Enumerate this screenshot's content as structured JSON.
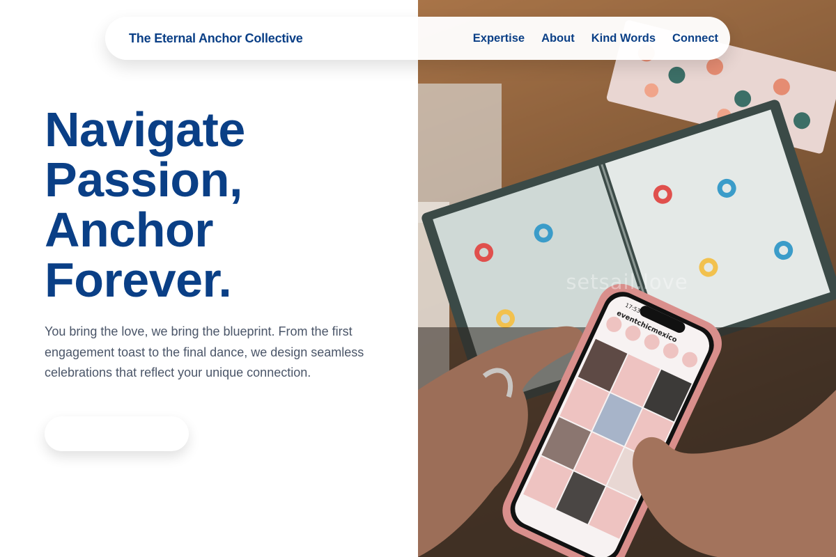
{
  "header": {
    "brand": "The Eternal Anchor Collective",
    "nav": [
      {
        "label": "Expertise"
      },
      {
        "label": "About"
      },
      {
        "label": "Kind Words"
      },
      {
        "label": "Connect"
      }
    ]
  },
  "hero": {
    "headline_lines": [
      "Navigate",
      "Passion,",
      "Anchor",
      "Forever."
    ],
    "intro": "You bring the love, we bring the blueprint. From the first engagement toast to the final dance, we design seamless celebrations that reflect your unique connection.",
    "cta_label": ""
  },
  "image": {
    "watermark": "setsail.love",
    "phone_time": "17:53",
    "phone_handle": "eventchicmexico"
  },
  "colors": {
    "brand_blue": "#0a3f86",
    "body_text": "#4a5568",
    "phone_case": "#d98f8c",
    "tile_pink": "#eec3c1"
  }
}
